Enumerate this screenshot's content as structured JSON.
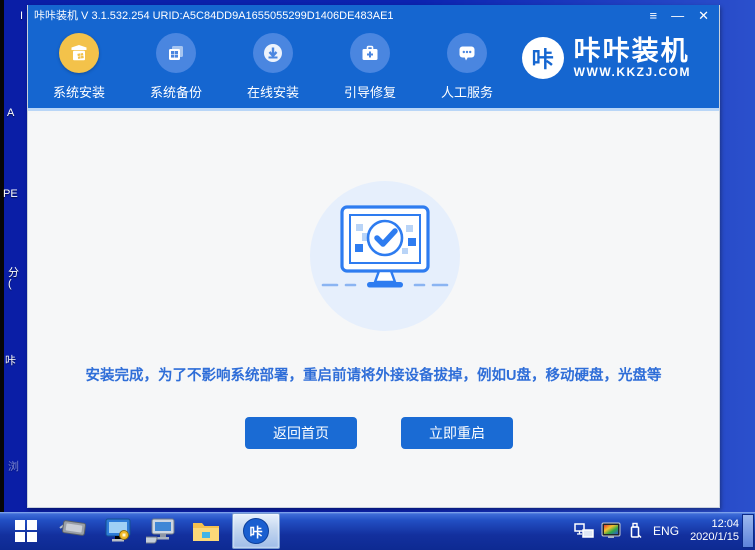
{
  "window": {
    "title": "咔咔装机 V 3.1.532.254 URID:A5C84DD9A1655055299D1406DE483AE1",
    "controls": {
      "menu": "≡",
      "minimize": "—",
      "close": "✕"
    }
  },
  "nav": {
    "items": [
      {
        "label": "系统安装",
        "active": true
      },
      {
        "label": "系统备份",
        "active": false
      },
      {
        "label": "在线安装",
        "active": false
      },
      {
        "label": "引导修复",
        "active": false
      },
      {
        "label": "人工服务",
        "active": false
      }
    ],
    "logo": {
      "badge": "咔",
      "name": "咔咔装机",
      "site": "WWW.KKZJ.COM"
    }
  },
  "main": {
    "message": "安装完成，为了不影响系统部署，重启前请将外接设备拔掉，例如U盘，移动硬盘，光盘等",
    "buttons": [
      {
        "label": "返回首页"
      },
      {
        "label": "立即重启"
      }
    ]
  },
  "taskbar": {
    "app_badge": "咔",
    "language": "ENG",
    "clock": {
      "time": "12:04",
      "date": "2020/1/15"
    }
  },
  "desktop": {
    "labels": [
      {
        "text": "I"
      },
      {
        "text": "A"
      },
      {
        "text": "PE"
      },
      {
        "text": "分"
      },
      {
        "text": "("
      },
      {
        "text": "咔"
      },
      {
        "text": "浏"
      }
    ]
  },
  "colors": {
    "header_blue": "#1566d0",
    "active_gold": "#f3c24a",
    "button_blue": "#1a6bd4",
    "message_blue": "#2f6ed8",
    "desktop_blue": "#0c23b0"
  }
}
